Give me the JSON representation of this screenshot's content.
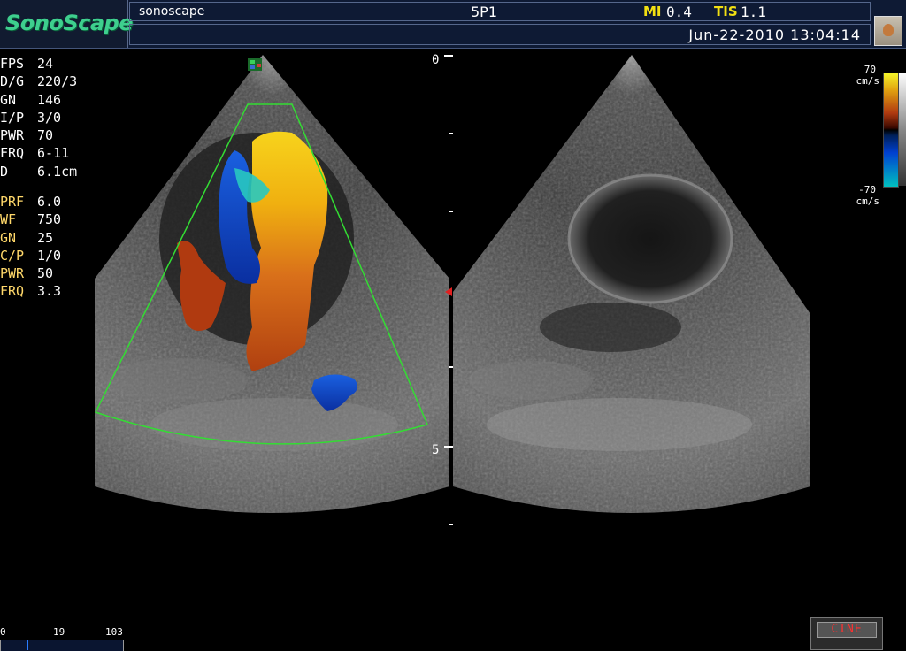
{
  "header": {
    "logo": "SonoScape",
    "hospital": "sonoscape",
    "probe": "5P1",
    "mi_label": "MI",
    "mi_value": "0.4",
    "tis_label": "TIS",
    "tis_value": "1.1",
    "datetime": "Jun-22-2010 13:04:14"
  },
  "bmode_params": [
    {
      "label": "FPS",
      "value": "24"
    },
    {
      "label": "D/G",
      "value": "220/3"
    },
    {
      "label": "GN",
      "value": "146"
    },
    {
      "label": "I/P",
      "value": "3/0"
    },
    {
      "label": "PWR",
      "value": "70"
    },
    {
      "label": "FRQ",
      "value": "6-11"
    },
    {
      "label": "D",
      "value": "6.1cm"
    }
  ],
  "color_params": [
    {
      "label": "PRF",
      "value": "6.0"
    },
    {
      "label": "WF",
      "value": "750"
    },
    {
      "label": "GN",
      "value": "25"
    },
    {
      "label": "C/P",
      "value": "1/0"
    },
    {
      "label": "PWR",
      "value": "50"
    },
    {
      "label": "FRQ",
      "value": "3.3"
    }
  ],
  "depth_scale": {
    "top": "0",
    "mid": "5"
  },
  "color_scale": {
    "max": "70",
    "min": "-70",
    "unit": "cm/s"
  },
  "cine": {
    "start": "0",
    "current": "19",
    "end": "103",
    "button": "CINE"
  },
  "colors": {
    "roi": "#33dd33",
    "logo": "#3ecf8e",
    "label_yellow": "#f2e012"
  }
}
